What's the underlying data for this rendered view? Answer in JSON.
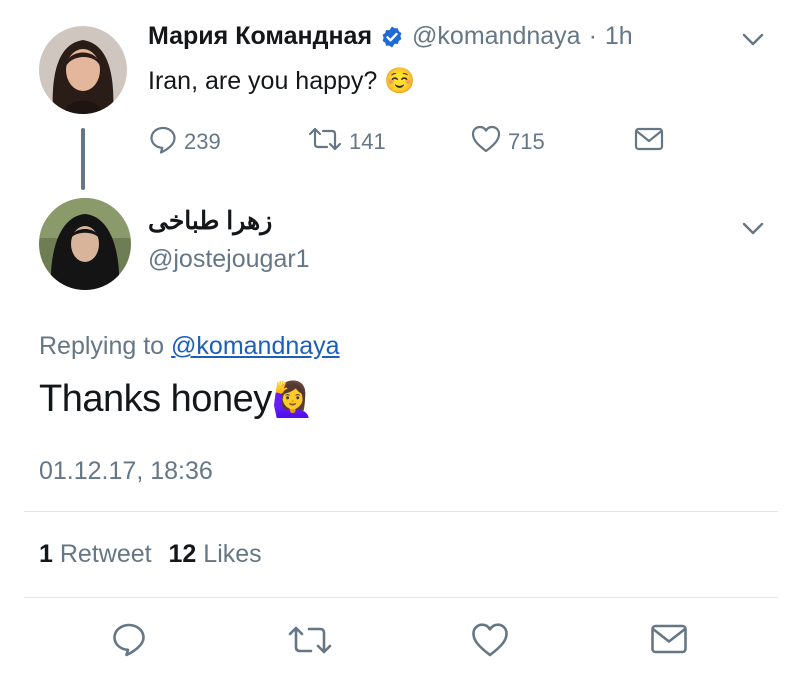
{
  "original_tweet": {
    "display_name": "Мария Командная",
    "handle": "@komandnaya",
    "separator": "·",
    "time": "1h",
    "text": "Iran, are you happy?",
    "emoji": "☺️",
    "stats": {
      "replies": "239",
      "retweets": "141",
      "likes": "715"
    }
  },
  "reply_tweet": {
    "display_name": "زهرا طباخی",
    "handle": "@jostejougar1",
    "replying_prefix": "Replying to",
    "replying_to": "@komandnaya",
    "text": "Thanks honey",
    "emoji": "🙋‍♀️",
    "timestamp": "01.12.17, 18:36"
  },
  "engagement": {
    "retweet_count": "1",
    "retweet_label": "Retweet",
    "like_count": "12",
    "like_label": "Likes"
  },
  "icons": {
    "reply": "reply-icon",
    "retweet": "retweet-icon",
    "like": "heart-icon",
    "message": "envelope-icon",
    "menu": "chevron-down-icon",
    "verified": "verified-badge-icon"
  },
  "colors": {
    "verified": "#1d6ad8",
    "link": "#1b5fbd",
    "muted": "#657786"
  }
}
